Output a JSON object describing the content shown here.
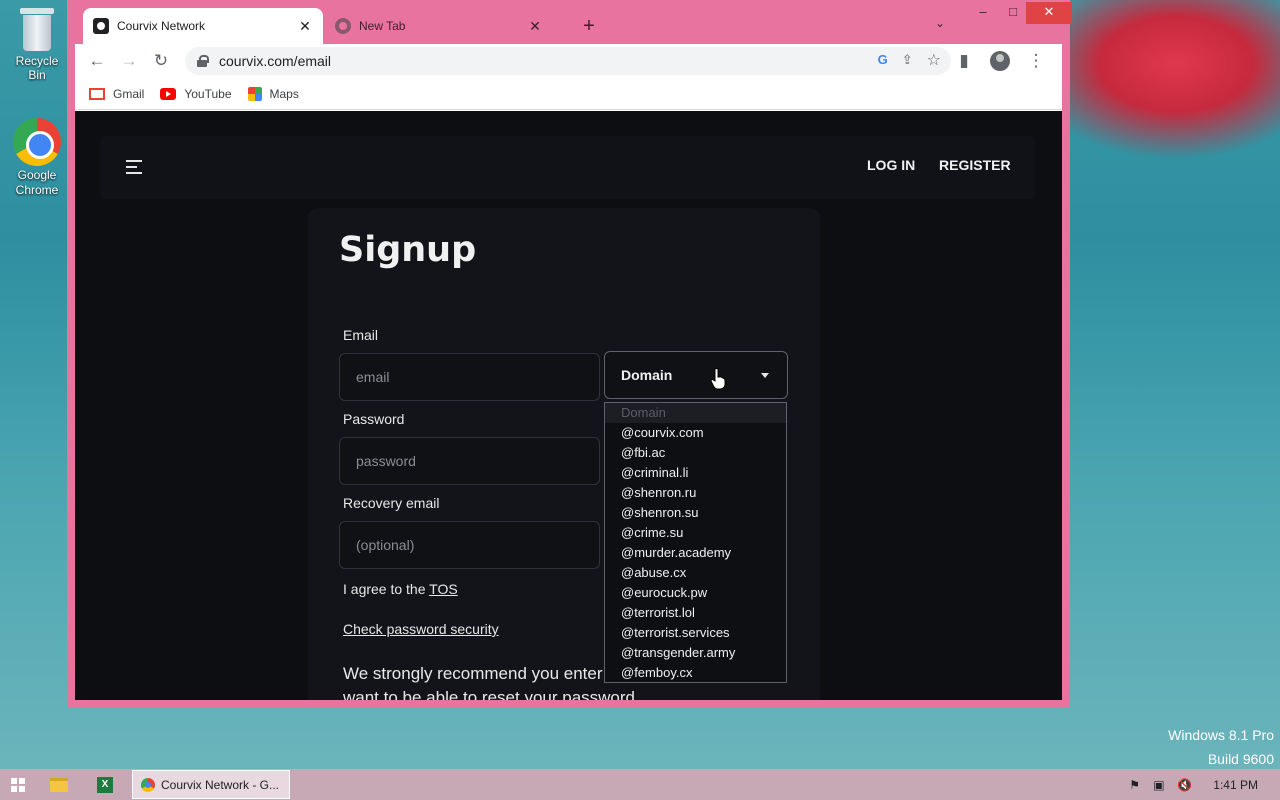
{
  "desktop": {
    "icons": [
      {
        "label": "Recycle Bin"
      },
      {
        "label": "Google Chrome"
      }
    ],
    "watermark": {
      "line1": "Windows 8.1 Pro",
      "line2": "Build 9600"
    }
  },
  "browser": {
    "tabs": [
      {
        "title": "Courvix Network",
        "close": "✕",
        "active": true
      },
      {
        "title": "New Tab",
        "close": "✕",
        "active": false
      }
    ],
    "new_tab": "+",
    "tab_search": "⌄",
    "window_controls": {
      "minimize": "–",
      "maximize": "□",
      "close": "✕"
    },
    "nav": {
      "back": "←",
      "forward": "→",
      "reload": "↻"
    },
    "url": "courvix.com/email",
    "omnibox_icons": {
      "google": "G",
      "share": "⇪",
      "bookmark": "☆"
    },
    "toolbar_icons": {
      "side_panel": "▮",
      "menu": "⋮"
    },
    "bookmarks": [
      {
        "label": "Gmail"
      },
      {
        "label": "YouTube"
      },
      {
        "label": "Maps"
      }
    ]
  },
  "page": {
    "nav": {
      "login": "LOG IN",
      "register": "REGISTER"
    },
    "title": "Signup",
    "email": {
      "label": "Email",
      "placeholder": "email"
    },
    "domain_select": {
      "selected": "Domain"
    },
    "password": {
      "label": "Password",
      "placeholder": "password"
    },
    "recovery": {
      "label": "Recovery email",
      "placeholder": "(optional)"
    },
    "tos_prefix": "I agree to the ",
    "tos_link": "TOS",
    "check_password": "Check password security",
    "recommend_line1": "We strongly recommend you enter a",
    "recommend_line2": "want to be able to reset your password",
    "dropdown_options": [
      "Domain",
      "@courvix.com",
      "@fbi.ac",
      "@criminal.li",
      "@shenron.ru",
      "@shenron.su",
      "@crime.su",
      "@murder.academy",
      "@abuse.cx",
      "@eurocuck.pw",
      "@terrorist.lol",
      "@terrorist.services",
      "@transgender.army",
      "@femboy.cx"
    ]
  },
  "taskbar": {
    "active_window": "Courvix Network - G...",
    "clock": "1:41 PM",
    "excel_glyph": "X",
    "tray_icons": {
      "flag": "⚑",
      "network": "▣",
      "volume": "🔇"
    }
  },
  "colors": {
    "window_frame": "#e8739e",
    "page_bg": "#0d0e12",
    "card_bg": "#121419",
    "taskbar": "#c7a9b6"
  }
}
